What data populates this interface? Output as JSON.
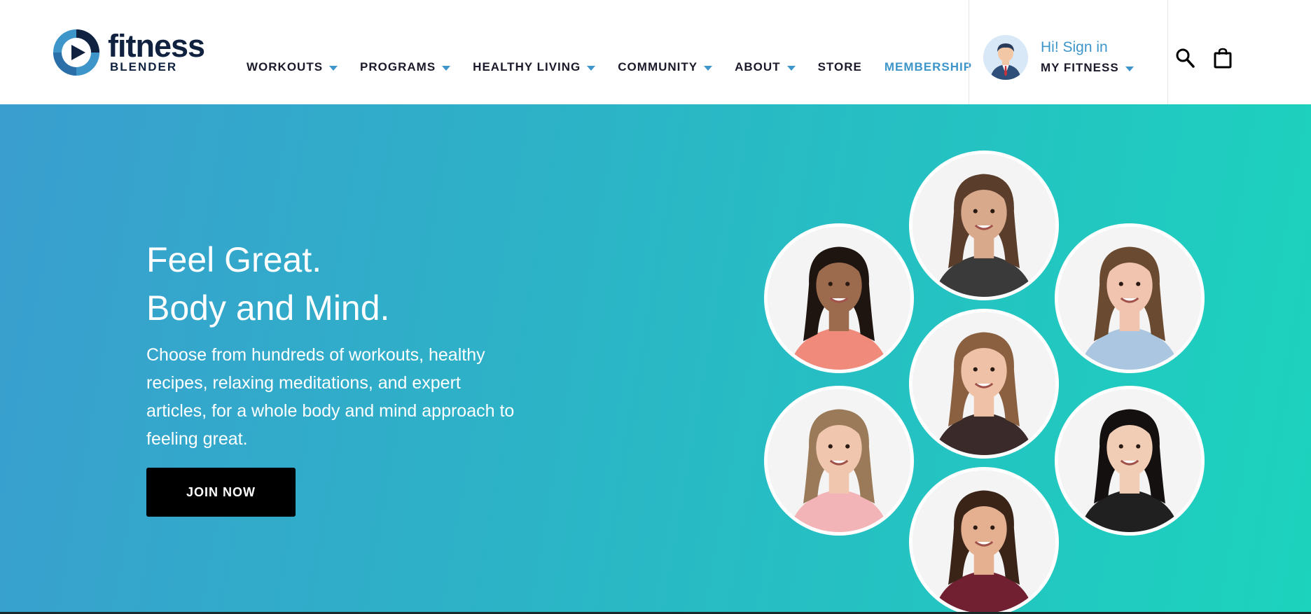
{
  "brand": {
    "name": "fitness",
    "sub": "BLENDER",
    "navy": "#10223f",
    "blue": "#3d95c9"
  },
  "nav": {
    "items": [
      {
        "label": "WORKOUTS",
        "dropdown": true
      },
      {
        "label": "PROGRAMS",
        "dropdown": true
      },
      {
        "label": "HEALTHY LIVING",
        "dropdown": true
      },
      {
        "label": "COMMUNITY",
        "dropdown": true
      },
      {
        "label": "ABOUT",
        "dropdown": true
      },
      {
        "label": "STORE",
        "dropdown": false
      },
      {
        "label": "MEMBERSHIP",
        "dropdown": false
      }
    ]
  },
  "account": {
    "greeting": "Hi! Sign in",
    "menu_label": "MY FITNESS"
  },
  "icons": {
    "search": "search-icon",
    "cart": "shopping-bag-icon"
  },
  "hero": {
    "headline_line1": "Feel Great.",
    "headline_line2": "Body and Mind.",
    "description": "Choose from hundreds of workouts, healthy recipes, relaxing meditations, and expert articles, for a whole body and mind approach to feeling great.",
    "cta_label": "JOIN NOW",
    "gradient": [
      "#3a9ecf",
      "#2bb5c6",
      "#1cd3bd"
    ]
  },
  "trainers": [
    {
      "id": "trainer-man-top",
      "skin": "#d9a98c",
      "hair": "#5a3d2b",
      "shirt": "#3a3a3a"
    },
    {
      "id": "trainer-woman-left-top",
      "skin": "#9c6b4e",
      "hair": "#1e1410",
      "shirt": "#f08a7a"
    },
    {
      "id": "trainer-woman-right-top",
      "skin": "#f0c4ae",
      "hair": "#6a4a30",
      "shirt": "#aac6e0"
    },
    {
      "id": "trainer-woman-center",
      "skin": "#efc2a8",
      "hair": "#8a6040",
      "shirt": "#3a2a2a"
    },
    {
      "id": "trainer-woman-left-bottom",
      "skin": "#f0c6ae",
      "hair": "#9a7a58",
      "shirt": "#f3b4b8"
    },
    {
      "id": "trainer-woman-right-bottom",
      "skin": "#f2cdb5",
      "hair": "#141010",
      "shirt": "#202020"
    },
    {
      "id": "trainer-woman-bottom",
      "skin": "#e4b090",
      "hair": "#3a2418",
      "shirt": "#702030"
    }
  ]
}
